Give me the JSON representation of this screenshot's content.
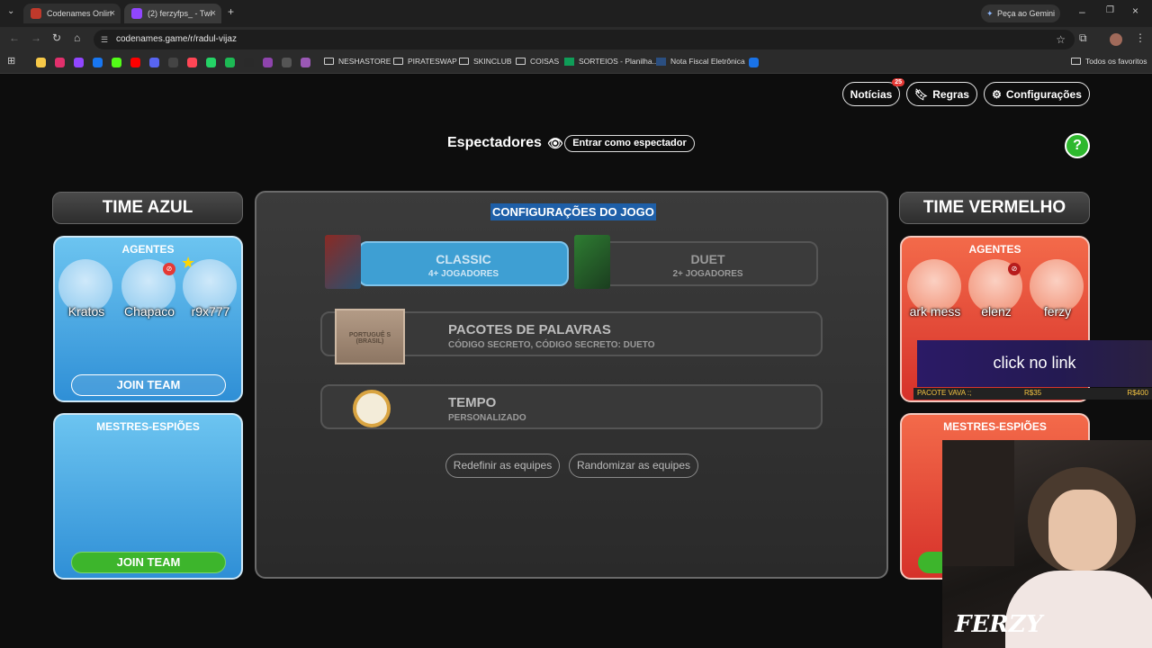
{
  "browser": {
    "tabs": [
      {
        "title": "Codenames Onlin"
      },
      {
        "title": "(2) ferzyfps_ - Twi"
      }
    ],
    "gemini_label": "Peça ao Gemini",
    "url": "codenames.game/r/radul-vijaz",
    "bookmarks": [
      "NESHASTORE",
      "PIRATESWAP",
      "SKINCLUB",
      "COISAS",
      "SORTEIOS - Planilha...",
      "Nota Fiscal Eletrônica"
    ],
    "all_bookmarks": "Todos os favoritos"
  },
  "top_nav": {
    "news": "Notícias",
    "news_badge": "25",
    "rules": "Regras",
    "settings": "Configurações"
  },
  "spectators": {
    "label": "Espectadores",
    "join_label": "Entrar como espectador"
  },
  "help_label": "?",
  "blue_team": {
    "title": "TIME AZUL",
    "agents_label": "AGENTES",
    "agents": [
      "Kratos",
      "Chapaco",
      "r9x777"
    ],
    "join_label": "JOIN TEAM",
    "spymasters_label": "MESTRES-ESPIÕES",
    "spy_join_label": "JOIN TEAM"
  },
  "red_team": {
    "title": "TIME VERMELHO",
    "agents_label": "AGENTES",
    "agents": [
      "ark mess",
      "elenz",
      "ferzy"
    ],
    "spymasters_label": "MESTRES-ESPIÕES"
  },
  "config": {
    "title": "CONFIGURAÇÕES DO JOGO",
    "modes": [
      {
        "name": "CLASSIC",
        "players": "4+ JOGADORES",
        "selected": true
      },
      {
        "name": "DUET",
        "players": "2+ JOGADORES",
        "selected": false
      }
    ],
    "word_packs_title": "PACOTES DE PALAVRAS",
    "word_packs_value": "CÓDIGO SECRETO, CÓDIGO SECRETO: DUETO",
    "box_label": "PORTUGUÊ S (BRASIL)",
    "time_title": "TEMPO",
    "time_value": "PERSONALIZADO",
    "reset_label": "Redefinir as equipes",
    "randomize_label": "Randomizar as equipes"
  },
  "stream_overlay": {
    "click_text": "click no link",
    "ticker_left": "PACOTE VAVA :;",
    "ticker_mid": "R$35",
    "ticker_right": "R$400",
    "streamer_logo": "FERZY"
  },
  "colors": {
    "blue_team": "#3fa9e8",
    "red_team": "#e8452f",
    "join_green": "#3db52c",
    "classic_selected": "#3e9fd3"
  }
}
